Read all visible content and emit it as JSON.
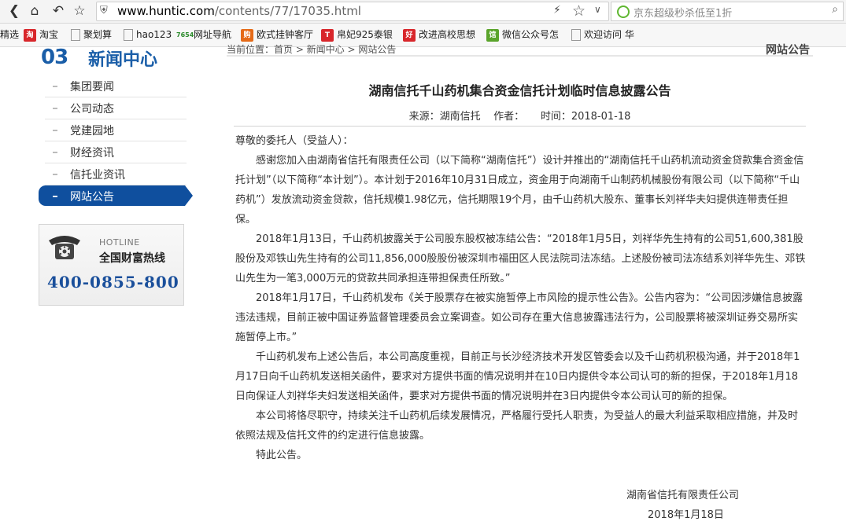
{
  "browser": {
    "url_domain": "www.huntic.com",
    "url_path": "/contents/77/17035.html",
    "search_placeholder": "京东超级秒杀低至1折"
  },
  "bookmarks": [
    {
      "label": "精选",
      "icon": "none"
    },
    {
      "label": "淘宝",
      "icon": "taobao-icon",
      "glyph": "淘"
    },
    {
      "label": "聚划算",
      "icon": "page-icon"
    },
    {
      "label": "hao123",
      "icon": "page-icon"
    },
    {
      "label": "网址导航",
      "icon": "7654-icon",
      "glyph": "7654"
    },
    {
      "label": "欧式挂钟客厅",
      "icon": "tmall-icon",
      "glyph": "购"
    },
    {
      "label": "帛妃925泰银",
      "icon": "tmall-icon",
      "glyph": "T"
    },
    {
      "label": "改进高校思想",
      "icon": "red-icon",
      "glyph": "好"
    },
    {
      "label": "微信公众号怎",
      "icon": "green-icon",
      "glyph": "馆"
    },
    {
      "label": "欢迎访问 华",
      "icon": "page-icon"
    }
  ],
  "sidebar": {
    "number": "03",
    "title": "新闻中心",
    "items": [
      {
        "label": "集团要闻",
        "active": false
      },
      {
        "label": "公司动态",
        "active": false
      },
      {
        "label": "党建园地",
        "active": false
      },
      {
        "label": "财经资讯",
        "active": false
      },
      {
        "label": "信托业资讯",
        "active": false
      },
      {
        "label": "网站公告",
        "active": true
      }
    ],
    "hotline": {
      "en": "HOTLINE",
      "cn": "全国财富热线",
      "number": "400-0855-800"
    }
  },
  "breadcrumb": "当前位置：首页 > 新闻中心 > 网站公告",
  "page_tag": "网站公告",
  "article": {
    "title": "湖南信托千山药机集合资金信托计划临时信息披露公告",
    "meta": "来源：湖南信托    作者：     时间：2018-01-18",
    "salutation": "尊敬的委托人（受益人）：",
    "paragraphs": [
      "感谢您加入由湖南省信托有限责任公司（以下简称“湖南信托”）设计并推出的“湖南信托千山药机流动资金贷款集合资金信托计划”（以下简称“本计划”）。本计划于2016年10月31日成立，资金用于向湖南千山制药机械股份有限公司（以下简称“千山药机”）发放流动资金贷款，信托规模1.98亿元，信托期限19个月，由千山药机大股东、董事长刘祥华夫妇提供连带责任担保。",
      "2018年1月13日，千山药机披露关于公司股东股权被冻结公告：“2018年1月5日，刘祥华先生持有的公司51,600,381股股份及邓铁山先生持有的公司11,856,000股股份被深圳市福田区人民法院司法冻结。上述股份被司法冻结系刘祥华先生、邓铁山先生为一笔3,000万元的贷款共同承担连带担保责任所致。”",
      "2018年1月17日，千山药机发布《关于股票存在被实施暂停上市风险的提示性公告》。公告内容为：“公司因涉嫌信息披露违法违规，目前正被中国证券监督管理委员会立案调查。如公司存在重大信息披露违法行为，公司股票将被深圳证券交易所实施暂停上市。”",
      "千山药机发布上述公告后，本公司高度重视，目前正与长沙经济技术开发区管委会以及千山药机积极沟通，并于2018年1月17日向千山药机发送相关函件，要求对方提供书面的情况说明并在10日内提供令本公司认可的新的担保，于2018年1月18日向保证人刘祥华夫妇发送相关函件，要求对方提供书面的情况说明并在3日内提供令本公司认可的新的担保。",
      "本公司将恪尽职守，持续关注千山药机后续发展情况，严格履行受托人职责，为受益人的最大利益采取相应措施，并及时依照法规及信托文件的约定进行信息披露。",
      "特此公告。"
    ],
    "signature_org": "湖南省信托有限责任公司",
    "signature_date": "2018年1月18日"
  }
}
